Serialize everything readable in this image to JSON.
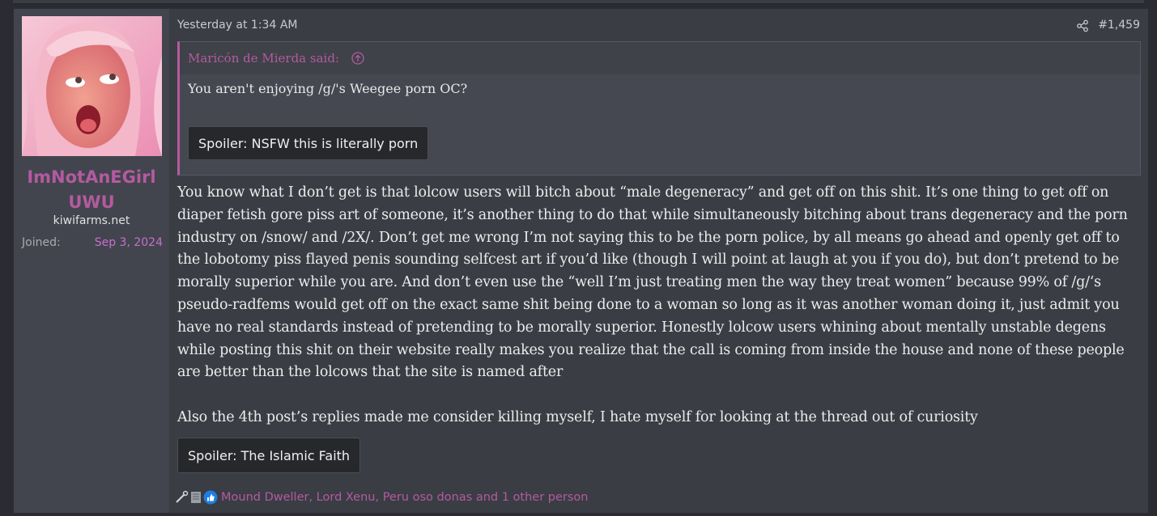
{
  "post": {
    "timestamp": "Yesterday at 1:34 AM",
    "post_number": "#1,459",
    "share_icon": "share-icon"
  },
  "user": {
    "name": "ImNotAnEGirlUWU",
    "title": "kiwifarms.net",
    "joined_label": "Joined:",
    "joined_value": "Sep 3, 2024",
    "avatar": "avatar-image"
  },
  "quote": {
    "author": "Maricón de Mierda said:",
    "text": "You aren't enjoying /g/'s Weegee porn OC?",
    "spoiler_label": "Spoiler: NSFW this is literally porn"
  },
  "body": {
    "paragraph1": "You know what I don’t get is that lolcow users will bitch about “male degeneracy” and get off on this shit. It’s one thing to get off on diaper fetish gore piss art of someone, it’s another thing to do that while simultaneously bitching about trans degeneracy and the porn industry on /snow/ and /2X/. Don’t get me wrong I’m not saying this to be the porn police, by all means go ahead and openly get off to the lobotomy piss flayed penis sounding selfcest art if you’d like (though I will point at laugh at you if you do), but don’t pretend to be morally superior while you are. And don’t even use the “well I’m just treating men the way they treat women” because 99% of /g/‘s pseudo-radfems would get off on the exact same shit being done to a woman so long as it was another woman doing it, just admit you have no real standards instead of pretending to be morally superior. Honestly lolcow users whining about mentally unstable degens while posting this shit on their website really makes you realize that the call is coming from inside the house and none of these people are better than the lolcows that the site is named after",
    "paragraph2": "Also the 4th post’s replies made me consider killing myself, I hate myself for looking at the thread out of curiosity",
    "spoiler_label": "Spoiler: The Islamic Faith"
  },
  "reactions": {
    "icons": [
      "wrench-icon",
      "scroll-icon",
      "thumbs-up-icon"
    ],
    "list": "Mound Dweller, Lord Xenu, Peru oso donas and 1 other person"
  },
  "colors": {
    "accent": "#b45aa0",
    "background": "#3a3d44",
    "user_cell": "#42454d"
  }
}
